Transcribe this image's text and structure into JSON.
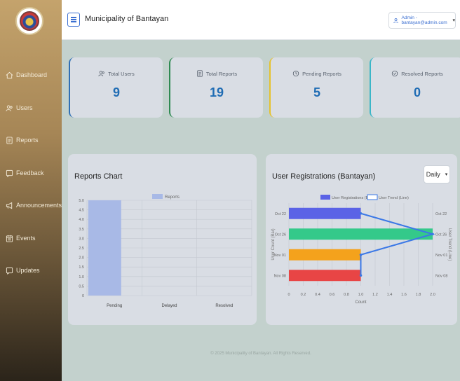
{
  "sidebar": {
    "items": [
      {
        "label": "Dashboard",
        "icon": "home-icon"
      },
      {
        "label": "Users",
        "icon": "users-icon"
      },
      {
        "label": "Reports",
        "icon": "report-icon"
      },
      {
        "label": "Feedback",
        "icon": "feedback-icon"
      },
      {
        "label": "Announcements",
        "icon": "megaphone-icon"
      },
      {
        "label": "Events",
        "icon": "calendar-icon"
      },
      {
        "label": "Updates",
        "icon": "updates-icon"
      }
    ]
  },
  "header": {
    "title": "Municipality of Bantayan",
    "user": "Admin - bantayan@admin.com"
  },
  "stats": [
    {
      "label": "Total Users",
      "value": "9",
      "accent": "#2f6fb5",
      "icon": "users-icon"
    },
    {
      "label": "Total Reports",
      "value": "19",
      "accent": "#2f8a52",
      "icon": "report-icon"
    },
    {
      "label": "Pending Reports",
      "value": "5",
      "accent": "#e6c22c",
      "icon": "clock-icon"
    },
    {
      "label": "Resolved Reports",
      "value": "0",
      "accent": "#3bb6c8",
      "icon": "check-circle-icon"
    }
  ],
  "reports_panel": {
    "title": "Reports Chart"
  },
  "registrations_panel": {
    "title": "User Registrations (Bantayan)",
    "period": "Daily"
  },
  "footer": {
    "text": "© 2025 Municipality of Bantayan. All Rights Reserved."
  },
  "chart_data": [
    {
      "type": "bar",
      "categories": [
        "Pending",
        "Delayed",
        "Resolved"
      ],
      "series": [
        {
          "name": "Reports",
          "values": [
            5,
            0,
            0
          ],
          "color": "#a8b9e6"
        }
      ],
      "yticks": [
        "0",
        "0.5",
        "1.0",
        "1.5",
        "2.0",
        "2.5",
        "3.0",
        "3.5",
        "4.0",
        "4.5",
        "5.0"
      ],
      "ylim": [
        0,
        5
      ],
      "grid": true,
      "legend": "top"
    },
    {
      "type": "bar",
      "orientation": "horizontal",
      "categories": [
        "Oct 22",
        "Oct 26",
        "Nov 01",
        "Nov 08"
      ],
      "series": [
        {
          "name": "User Registrations (Bar)",
          "values": [
            1,
            2,
            1,
            1
          ],
          "colors": [
            "#5b63e6",
            "#34c98a",
            "#f4a21c",
            "#e84545"
          ]
        },
        {
          "name": "User Trend (Line)",
          "values": [
            1,
            2,
            1,
            1
          ],
          "color": "#3b78e6"
        }
      ],
      "xticks": [
        "0",
        "0.2",
        "0.4",
        "0.6",
        "0.8",
        "1.0",
        "1.2",
        "1.4",
        "1.6",
        "1.8",
        "2.0"
      ],
      "xlim": [
        0,
        2
      ],
      "xlabel": "Count",
      "ylabel": "User Count (Bar)",
      "ylabel_right": "User Trend (Line)",
      "legend": "top"
    }
  ]
}
